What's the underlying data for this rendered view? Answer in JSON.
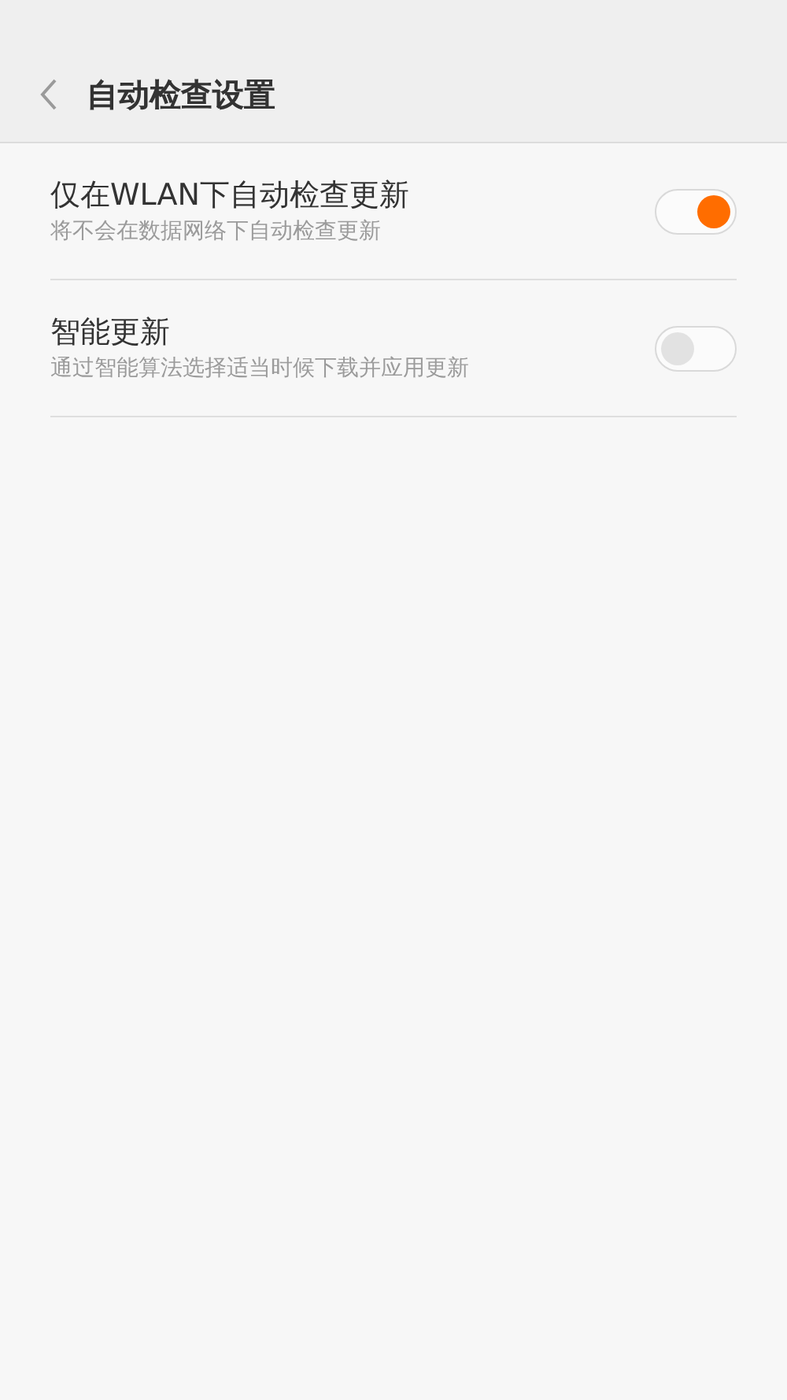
{
  "header": {
    "title": "自动检查设置"
  },
  "settings": [
    {
      "title": "仅在WLAN下自动检查更新",
      "subtitle": "将不会在数据网络下自动检查更新",
      "on": true
    },
    {
      "title": "智能更新",
      "subtitle": "通过智能算法选择适当时候下载并应用更新",
      "on": false
    }
  ]
}
